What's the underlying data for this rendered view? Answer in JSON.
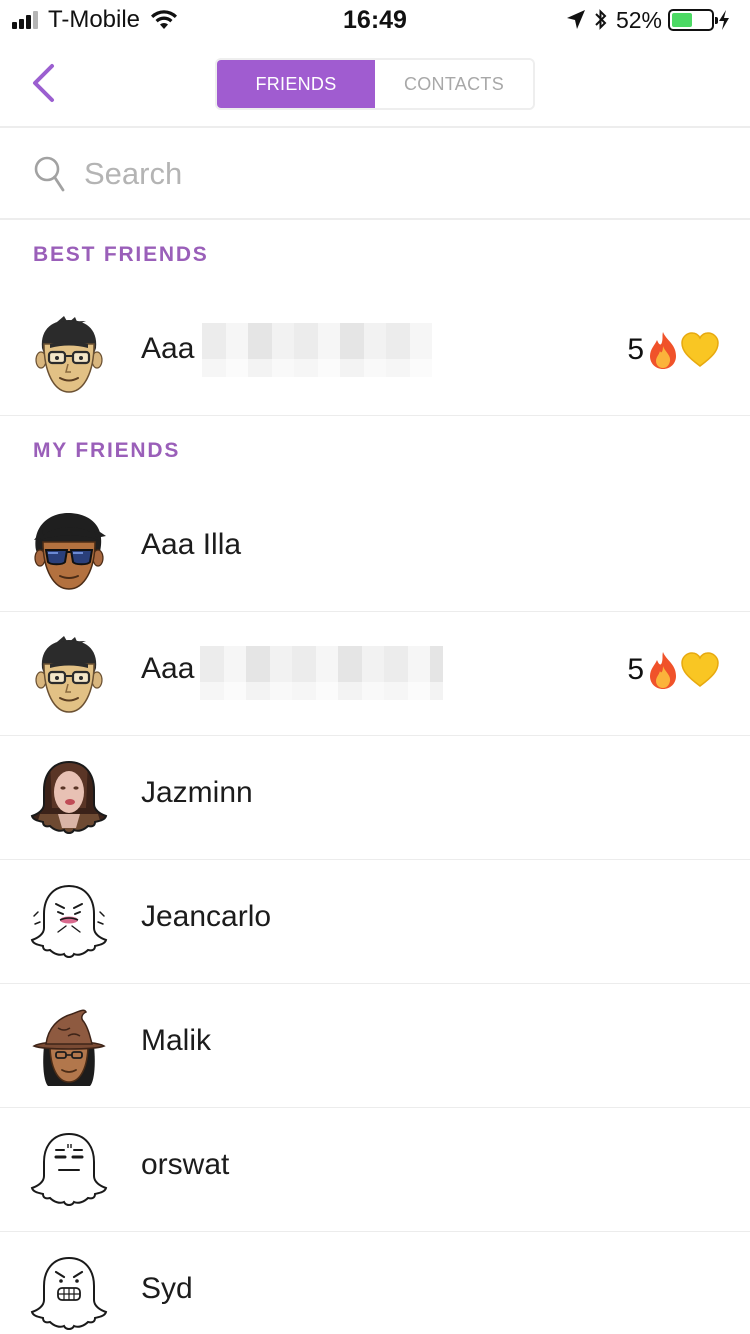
{
  "status_bar": {
    "carrier": "T-Mobile",
    "time": "16:49",
    "battery_percent": "52%",
    "battery_level": 0.52,
    "signal_bars": 4,
    "signal_bars_filled": 3
  },
  "nav": {
    "tabs": [
      {
        "label": "FRIENDS",
        "active": true
      },
      {
        "label": "CONTACTS",
        "active": false
      }
    ]
  },
  "search": {
    "placeholder": "Search"
  },
  "sections": {
    "best_friends": {
      "title": "BEST FRIENDS",
      "items": [
        {
          "name": "Aaa",
          "streak": "5",
          "icons": [
            "fire-emoji",
            "yellow-heart-emoji"
          ],
          "avatar": "bitmoji-glasses"
        }
      ]
    },
    "my_friends": {
      "title": "MY FRIENDS",
      "items": [
        {
          "name": "Aaa Illa",
          "avatar": "bitmoji-sunglasses"
        },
        {
          "name": "Aaa",
          "streak": "5",
          "icons": [
            "fire-emoji",
            "yellow-heart-emoji"
          ],
          "avatar": "bitmoji-glasses"
        },
        {
          "name": "Jazminn",
          "avatar": "ghost-photo"
        },
        {
          "name": "Jeancarlo",
          "avatar": "ghost-worried"
        },
        {
          "name": "Malik",
          "avatar": "bitmoji-wizard-hat"
        },
        {
          "name": "orswat",
          "avatar": "ghost-unamused"
        },
        {
          "name": "Syd",
          "avatar": "ghost-grimace"
        }
      ]
    }
  },
  "colors": {
    "accent": "#a05cd0",
    "section_header": "#9a5fb9",
    "battery_fill": "#4cd964",
    "divider": "#ededed"
  }
}
